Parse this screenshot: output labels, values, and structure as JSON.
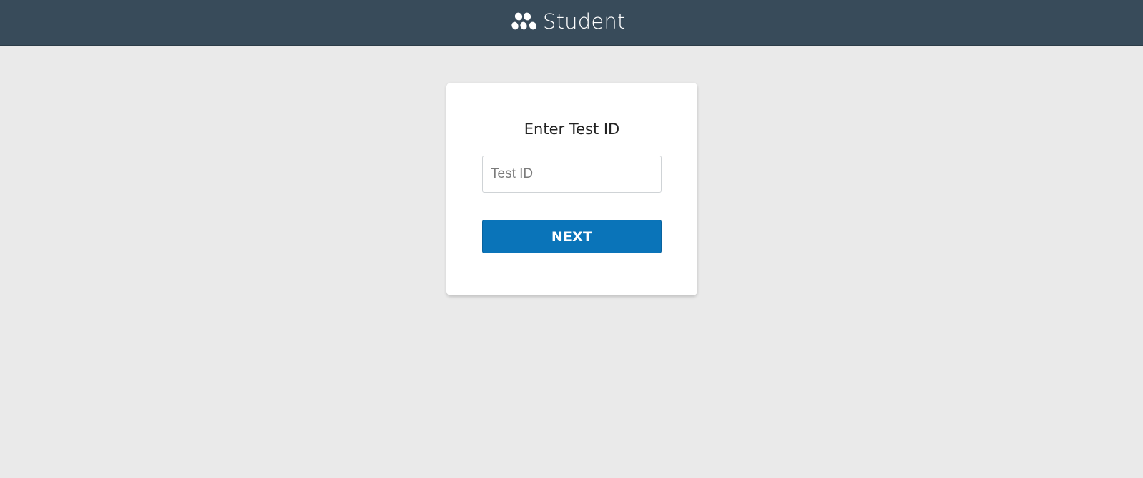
{
  "header": {
    "logo_icon": "three-dots-logo-icon",
    "title": "Student",
    "background_color": "#384b5a"
  },
  "card": {
    "title": "Enter Test ID",
    "test_id_input": {
      "value": "",
      "placeholder": "Test ID"
    },
    "next_button_label": "NEXT",
    "button_color": "#0a74b9"
  }
}
